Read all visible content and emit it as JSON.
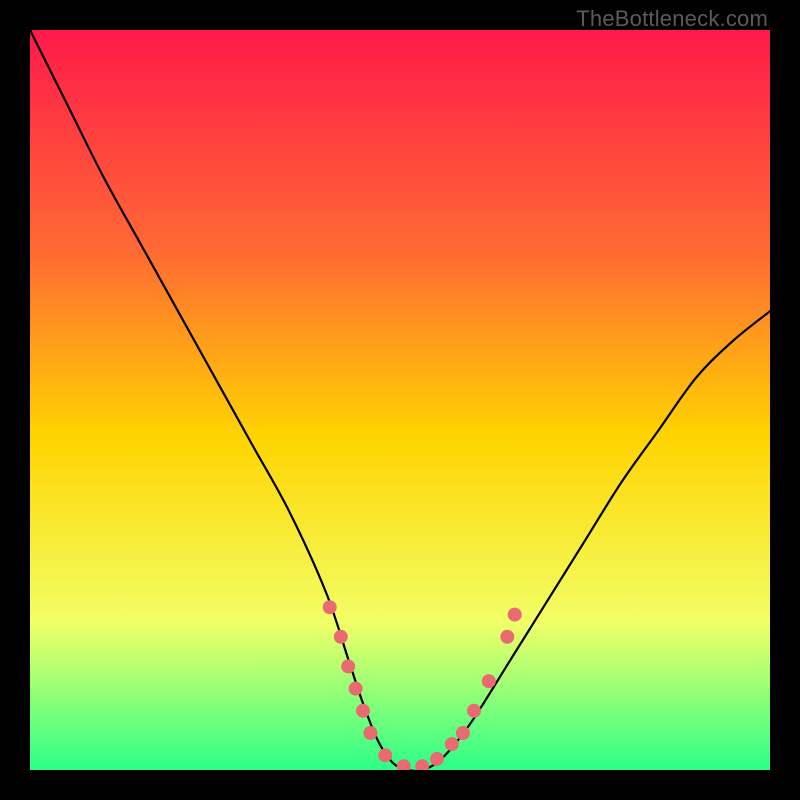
{
  "watermark": "TheBottleneck.com",
  "chart_data": {
    "type": "line",
    "title": "",
    "xlabel": "",
    "ylabel": "",
    "xlim": [
      0,
      100
    ],
    "ylim": [
      0,
      100
    ],
    "grid": false,
    "legend": false,
    "background_gradient": {
      "top": "#ff1a4a",
      "upper_mid": "#ff6a33",
      "mid": "#ffd400",
      "lower_mid": "#f2ff66",
      "bottom": "#2aff88"
    },
    "series": [
      {
        "name": "bottleneck-curve",
        "color": "#000000",
        "x": [
          0,
          5,
          10,
          15,
          20,
          25,
          30,
          35,
          40,
          43,
          45,
          47,
          49,
          51,
          53,
          55,
          57,
          60,
          65,
          70,
          75,
          80,
          85,
          90,
          95,
          100
        ],
        "y": [
          100,
          90,
          80,
          71,
          62,
          53,
          44,
          35,
          24,
          15,
          9,
          4,
          1,
          0,
          0,
          1,
          3,
          7,
          15,
          23,
          31,
          39,
          46,
          53,
          58,
          62
        ]
      }
    ],
    "markers": {
      "name": "highlight-dots",
      "color": "#e96a71",
      "radius_px": 7,
      "x": [
        40.5,
        42,
        43,
        44,
        45,
        46,
        48,
        50.5,
        53,
        55,
        57,
        58.5,
        60,
        62,
        64.5,
        65.5
      ],
      "y": [
        22,
        18,
        14,
        11,
        8,
        5,
        2,
        0.5,
        0.5,
        1.5,
        3.5,
        5,
        8,
        12,
        18,
        21
      ]
    }
  }
}
